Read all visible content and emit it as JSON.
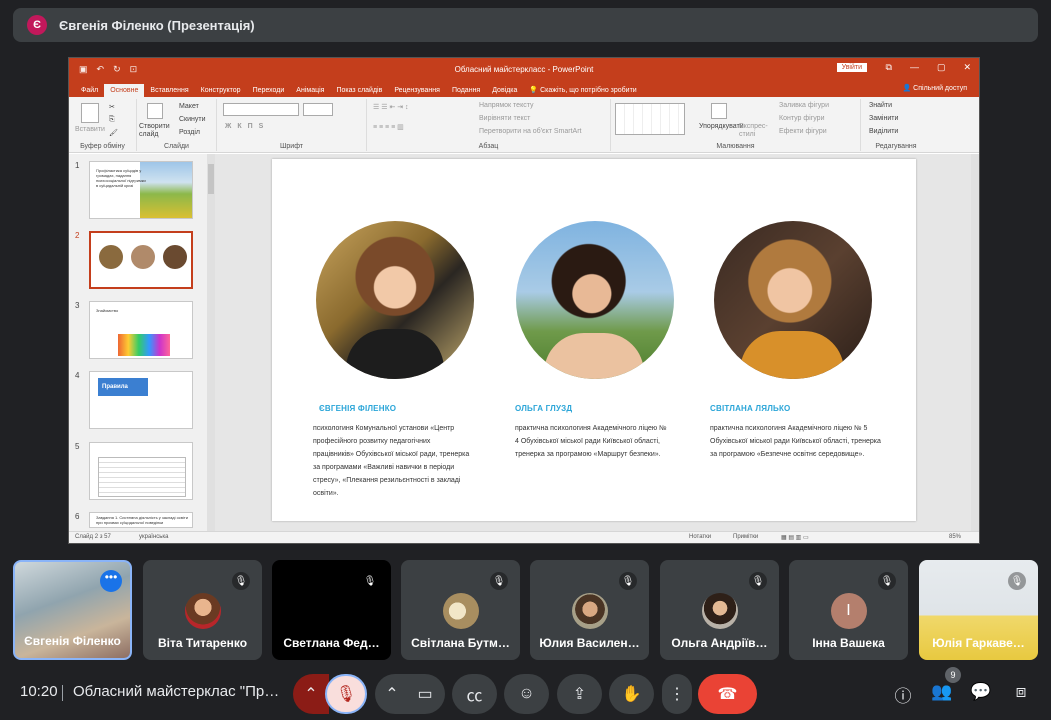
{
  "meet": {
    "presenter_initial": "Є",
    "presenter_title": "Євгенія Філенко (Презентація)",
    "time": "10:20",
    "meeting_title": "Обласний майстерклас \"Проф…",
    "people_badge": "9"
  },
  "ppt": {
    "window_title": "Обласний майстеркласс - PowerPoint",
    "signin": "Увійти",
    "share": "Спільний доступ",
    "tabs": [
      "Файл",
      "Основне",
      "Вставлення",
      "Конструктор",
      "Переходи",
      "Анімація",
      "Показ слайдів",
      "Рецензування",
      "Подання",
      "Довідка"
    ],
    "tell_me": "Скажіть, що потрібно зробити",
    "ribbon": {
      "paste": "Вставити",
      "clipboard": "Буфер обміну",
      "new_slide": "Створити слайд",
      "layout": "Макет",
      "reset": "Скинути",
      "section": "Розділ",
      "slides": "Слайди",
      "font": "Шрифт",
      "text_direction": "Напрямок тексту",
      "align_text": "Вирівняти текст",
      "smartart": "Перетворити на об'єкт SmartArt",
      "paragraph": "Абзац",
      "arrange": "Упорядкувати",
      "quick_styles": "Експрес-стилі",
      "shape_fill": "Заливка фігури",
      "shape_outline": "Контур фігури",
      "shape_effects": "Ефекти фігури",
      "drawing": "Малювання",
      "find": "Знайти",
      "replace": "Замінити",
      "select": "Виділити",
      "editing": "Редагування"
    },
    "thumbs": {
      "n1": "1",
      "n2": "2",
      "n3": "3",
      "n4": "4",
      "n5": "5",
      "n6": "6",
      "t1": "Профілактика суїцидів у громадах, надання психосоціальної підтримки в суїцидальній кризі",
      "t3": "Знайомство",
      "t4": "Правила",
      "t6": "Завдання 1. Системна діяльність у закладі освіти при проявах суїцидальної поведінки"
    },
    "slide": {
      "person1": {
        "name": "ЄВГЕНІЯ ФІЛЕНКО",
        "desc": "психологиня Комунальної установи «Центр професійного розвитку педагогічних працівників» Обухівської міської ради, тренерка за програмами «Важливі навички в періоди стресу», «Плекання резильєнтності в закладі освіти»."
      },
      "person2": {
        "name": "ОЛЬГА ГЛУЗД",
        "desc": "практична психологиня Академічного ліцею № 4 Обухівської міської ради Київської області, тренерка за програмою «Маршрут безпеки»."
      },
      "person3": {
        "name": "СВІТЛАНА ЛЯЛЬКО",
        "desc": "практична психологиня Академічного ліцею № 5 Обухівської міської ради Київської області, тренерка за програмою «Безпечне освітнє середовище»."
      }
    },
    "status": {
      "slide_of": "Слайд 2 з 57",
      "language": "українська",
      "notes": "Нотатки",
      "comments": "Примітки",
      "zoom": "85%"
    }
  },
  "participants": [
    {
      "name": "Євгенія Філенко"
    },
    {
      "name": "Віта Титаренко"
    },
    {
      "name": "Светлана Фед…"
    },
    {
      "name": "Світлана Бутм…"
    },
    {
      "name": "Юлия Василен…"
    },
    {
      "name": "Ольга Андріїв…"
    },
    {
      "name": "Інна Вашека",
      "initial": "І"
    },
    {
      "name": "Юлія Гаркаве…"
    }
  ]
}
